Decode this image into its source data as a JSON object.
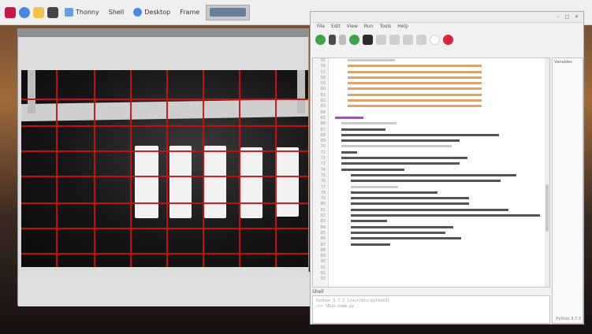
{
  "taskbar": {
    "items": [
      {
        "icon": "raspberry-icon",
        "color": "#c51a4a"
      },
      {
        "icon": "globe-icon",
        "color": "#4a89dc"
      },
      {
        "icon": "folder-icon",
        "color": "#f0c24b"
      },
      {
        "icon": "terminal-icon",
        "color": "#444444"
      }
    ],
    "tasks": [
      {
        "label": "Thonny",
        "icon": "thonny-icon",
        "color": "#6aa0d8"
      },
      {
        "label": "Shell",
        "icon": "shell-icon",
        "color": "#6aa0d8"
      },
      {
        "label": "Desktop",
        "icon": "globe-icon",
        "color": "#4a89dc"
      },
      {
        "label": "Frame",
        "icon": "frame-icon",
        "color": "#ffffff"
      },
      {
        "label": "",
        "icon": "window-icon",
        "color": "#6a7f9a"
      }
    ]
  },
  "camera_window": {
    "title": "",
    "grid_color": "#d40d0d"
  },
  "ide": {
    "title": "",
    "menu": [
      "File",
      "Edit",
      "View",
      "Run",
      "Tools",
      "Help"
    ],
    "tab": "",
    "toolbar": [
      {
        "name": "run-icon",
        "color": "#3fa34d"
      },
      {
        "name": "debug-icon",
        "color": "#4a4a4a"
      },
      {
        "name": "step-icon",
        "color": "#bdbdbd"
      },
      {
        "name": "resume-icon",
        "color": "#3fa34d"
      },
      {
        "name": "stop-icon",
        "color": "#2b2b2b"
      },
      {
        "name": "blank-icon",
        "color": "#cfcfcf"
      },
      {
        "name": "blank-icon",
        "color": "#cfcfcf"
      },
      {
        "name": "blank-icon",
        "color": "#cfcfcf"
      },
      {
        "name": "blank-icon",
        "color": "#cfcfcf"
      },
      {
        "name": "circle-icon",
        "color": "#cfcfcf"
      },
      {
        "name": "stop-sign-icon",
        "color": "#d6263b"
      }
    ],
    "line_numbers": [
      "55",
      "56",
      "57",
      "58",
      "59",
      "60",
      "61",
      "62",
      "63",
      "64",
      "65",
      "66",
      "67",
      "68",
      "69",
      "70",
      "71",
      "72",
      "73",
      "74",
      "75",
      "76",
      "77",
      "78",
      "79",
      "80",
      "81",
      "82",
      "83",
      "84",
      "85",
      "86",
      "87",
      "88",
      "89",
      "90",
      "91",
      "92",
      "93"
    ],
    "side_label": "Variables",
    "side_bottom": "Python 3.7.3",
    "shell_tab": "Shell",
    "shell_lines": [
      "Python 3.7.3 (/usr/bin/python3)",
      ">>> %Run code.py"
    ]
  }
}
